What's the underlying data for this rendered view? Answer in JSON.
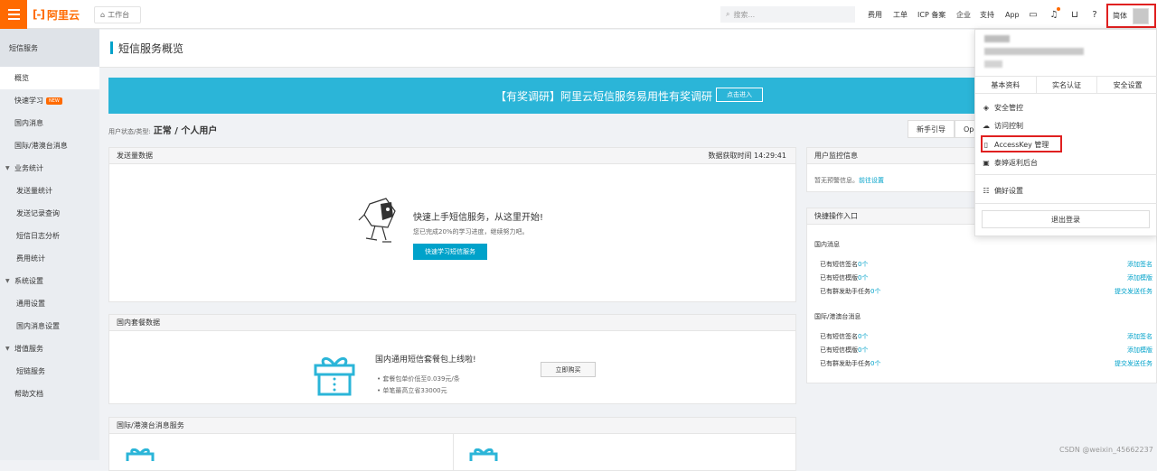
{
  "topbar": {
    "logo_text": "阿里云",
    "logo_mark": "[-]",
    "workbench": "工作台",
    "search_placeholder": "搜索...",
    "nav": [
      "费用",
      "工单",
      "ICP 备案",
      "企业",
      "支持",
      "App"
    ],
    "language": "简体"
  },
  "sidebar": {
    "title": "短信服务",
    "items": [
      {
        "label": "概览",
        "type": "top",
        "active": true
      },
      {
        "label": "快速学习",
        "type": "top",
        "badge": "NEW"
      },
      {
        "label": "国内消息",
        "type": "top"
      },
      {
        "label": "国际/港澳台消息",
        "type": "top"
      },
      {
        "label": "业务统计",
        "type": "group"
      },
      {
        "label": "发送量统计",
        "type": "sub"
      },
      {
        "label": "发送记录查询",
        "type": "sub"
      },
      {
        "label": "短信日志分析",
        "type": "sub"
      },
      {
        "label": "费用统计",
        "type": "sub"
      },
      {
        "label": "系统设置",
        "type": "group"
      },
      {
        "label": "通用设置",
        "type": "sub"
      },
      {
        "label": "国内消息设置",
        "type": "sub"
      },
      {
        "label": "增值服务",
        "type": "group"
      },
      {
        "label": "短链服务",
        "type": "sub"
      },
      {
        "label": "帮助文档",
        "type": "top"
      }
    ]
  },
  "page": {
    "title": "短信服务概览",
    "banner_text": "【有奖调研】阿里云短信服务易用性有奖调研",
    "banner_button": "点击进入",
    "user_status_label": "用户状态/类型:",
    "user_status_value": "正常 / 个人用户",
    "guide_buttons": [
      "新手引导",
      "Ope"
    ]
  },
  "send_card": {
    "title": "发送量数据",
    "time_label": "数据获取时间 14:29:41",
    "quick_title": "快速上手短信服务，从这里开始!",
    "quick_sub": "您已完成20%的学习进度，继续努力吧。",
    "quick_button": "快速学习短信服务"
  },
  "package_card": {
    "title": "国内套餐数据",
    "headline": "国内通用短信套餐包上线啦!",
    "bullets": [
      "套餐包单价低至0.039元/条",
      "单笔最高立省33000元"
    ],
    "buy_button": "立即购买"
  },
  "intl_card": {
    "title": "国际/港澳台消息服务"
  },
  "monitor_card": {
    "title": "用户监控信息",
    "text": "暂无预警信息。",
    "link": "前往设置"
  },
  "quick_card": {
    "title": "快捷操作入口",
    "sections": [
      {
        "heading": "国内消息",
        "rows": [
          {
            "label": "已有短信签名",
            "count": "0个",
            "action": "添加签名"
          },
          {
            "label": "已有短信模版",
            "count": "0个",
            "action": "添加模版"
          },
          {
            "label": "已有群发助手任务",
            "count": "0个",
            "action": "提交发送任务"
          }
        ]
      },
      {
        "heading": "国际/港澳台消息",
        "rows": [
          {
            "label": "已有短信签名",
            "count": "0个",
            "action": "添加签名"
          },
          {
            "label": "已有短信模版",
            "count": "0个",
            "action": "添加模版"
          },
          {
            "label": "已有群发助手任务",
            "count": "0个",
            "action": "提交发送任务"
          }
        ]
      }
    ]
  },
  "dropdown": {
    "tabs": [
      "基本资料",
      "实名认证",
      "安全设置"
    ],
    "items": [
      "安全管控",
      "访问控制",
      "AccessKey 管理",
      "泰婷返利后台",
      "偏好设置"
    ],
    "logout": "退出登录"
  },
  "watermark": "CSDN @weixin_45662237",
  "colors": {
    "brand": "#ff6a00",
    "accent": "#00a2ca",
    "banner": "#2bb5d8",
    "highlight": "#e02020"
  }
}
